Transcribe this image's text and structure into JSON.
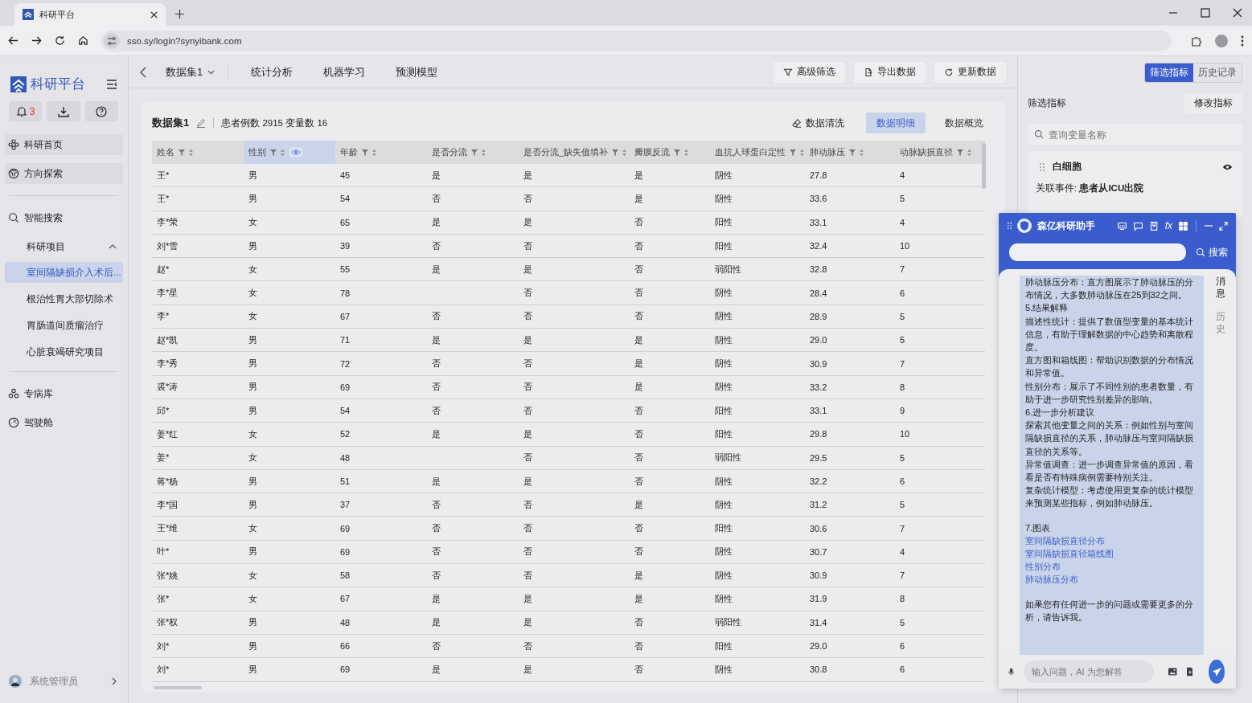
{
  "browser": {
    "tab_title": "科研平台",
    "url": "sso.sy/login?synyibank.com"
  },
  "sidebar": {
    "brand": "科研平台",
    "notification_count": "3",
    "items": [
      {
        "kind": "card",
        "label": "科研首页"
      },
      {
        "kind": "card",
        "label": "方向探索"
      },
      {
        "kind": "divider"
      },
      {
        "kind": "link",
        "label": "智能搜索"
      },
      {
        "kind": "group",
        "label": "科研项目",
        "expanded": true,
        "children": [
          {
            "label": "室间隔缺损介入术后...",
            "selected": true
          },
          {
            "label": "根治性胃大部切除术",
            "selected": false
          },
          {
            "label": "胃肠道间质瘤治疗",
            "selected": false
          },
          {
            "label": "心脏衰竭研究项目",
            "selected": false
          }
        ]
      },
      {
        "kind": "divider"
      },
      {
        "kind": "link",
        "label": "专病库"
      },
      {
        "kind": "link",
        "label": "驾驶舱"
      }
    ],
    "user": {
      "name": "系统管理员"
    }
  },
  "topbar": {
    "tabs": [
      {
        "label": "数据集1",
        "dropdown": true
      },
      {
        "label": "统计分析",
        "dropdown": false
      },
      {
        "label": "机器学习",
        "dropdown": false
      },
      {
        "label": "预测模型",
        "dropdown": false
      }
    ],
    "buttons": [
      {
        "label": "高级筛选"
      },
      {
        "label": "导出数据"
      },
      {
        "label": "更新数据"
      }
    ]
  },
  "dataset": {
    "title": "数据集1",
    "summary": "患者例数 2915 变量数 16",
    "action": "数据清洗",
    "views": [
      {
        "label": "数据明细",
        "selected": true
      },
      {
        "label": "数据概览",
        "selected": false
      }
    ]
  },
  "table": {
    "columns": [
      {
        "label": "姓名",
        "selected": false
      },
      {
        "label": "性别",
        "selected": true
      },
      {
        "label": "年龄",
        "selected": false
      },
      {
        "label": "是否分流",
        "selected": false
      },
      {
        "label": "是否分流_缺失值填补",
        "selected": false
      },
      {
        "label": "瓣膜反流",
        "selected": false
      },
      {
        "label": "血抗人球蛋白定性",
        "selected": false
      },
      {
        "label": "肺动脉压",
        "selected": false
      },
      {
        "label": "动脉缺损直径",
        "selected": false
      }
    ],
    "rows": [
      [
        "王*",
        "男",
        "45",
        "是",
        "是",
        "是",
        "阴性",
        "27.8",
        "4"
      ],
      [
        "王*",
        "男",
        "54",
        "否",
        "否",
        "是",
        "阴性",
        "33.6",
        "5"
      ],
      [
        "李*荣",
        "女",
        "65",
        "是",
        "是",
        "否",
        "阳性",
        "33.1",
        "4"
      ],
      [
        "刘*雪",
        "男",
        "39",
        "否",
        "否",
        "否",
        "阳性",
        "32.4",
        "10"
      ],
      [
        "赵*",
        "女",
        "55",
        "是",
        "是",
        "否",
        "弱阳性",
        "32.8",
        "7"
      ],
      [
        "李*星",
        "女",
        "78",
        null,
        "否",
        "否",
        "阴性",
        "28.4",
        "6"
      ],
      [
        "李*",
        "女",
        "67",
        "否",
        "否",
        "否",
        "阴性",
        "28.9",
        "5"
      ],
      [
        "赵*凯",
        "男",
        "71",
        "是",
        "是",
        "是",
        "阴性",
        "29.0",
        "5"
      ],
      [
        "李*秀",
        "男",
        "72",
        "否",
        "否",
        "是",
        "阴性",
        "30.9",
        "7"
      ],
      [
        "裘*涛",
        "男",
        "69",
        "否",
        "否",
        "是",
        "阴性",
        "33.2",
        "8"
      ],
      [
        "邱*",
        "男",
        "54",
        "否",
        "否",
        "否",
        "阳性",
        "33.1",
        "9"
      ],
      [
        "姜*红",
        "女",
        "52",
        "是",
        "是",
        "否",
        "阳性",
        "29.8",
        "10"
      ],
      [
        "姜*",
        "女",
        "48",
        null,
        "否",
        "否",
        "弱阳性",
        "29.5",
        "5"
      ],
      [
        "蒋*杨",
        "男",
        "51",
        "是",
        "是",
        "否",
        "阴性",
        "32.2",
        "6"
      ],
      [
        "李*国",
        "男",
        "37",
        "否",
        "否",
        "是",
        "阴性",
        "31.2",
        "5"
      ],
      [
        "王*维",
        "女",
        "69",
        "否",
        "否",
        "否",
        "阳性",
        "30.6",
        "7"
      ],
      [
        "叶*",
        "男",
        "69",
        "否",
        "否",
        "否",
        "阴性",
        "30.7",
        "4"
      ],
      [
        "张*姚",
        "女",
        "58",
        "否",
        "否",
        "是",
        "阴性",
        "30.9",
        "7"
      ],
      [
        "张*",
        "女",
        "67",
        "是",
        "是",
        "是",
        "阴性",
        "31.9",
        "8"
      ],
      [
        "张*权",
        "男",
        "48",
        "是",
        "是",
        "否",
        "弱阳性",
        "31.4",
        "5"
      ],
      [
        "刘*",
        "男",
        "66",
        "否",
        "否",
        "否",
        "阳性",
        "29.0",
        "6"
      ],
      [
        "刘*",
        "男",
        "69",
        "是",
        "是",
        "否",
        "阴性",
        "30.8",
        "6"
      ]
    ]
  },
  "right_panel": {
    "segments": [
      {
        "label": "筛选指标",
        "selected": true
      },
      {
        "label": "历史记录",
        "selected": false
      }
    ],
    "section_title": "筛选指标",
    "edit_button": "修改指标",
    "search_placeholder": "查询变量名称",
    "indicator": {
      "name": "白细胞",
      "visible": true,
      "event": "关联事件: **患者从ICU出院**"
    }
  },
  "assistant": {
    "title": "森亿科研助手",
    "toolbar": [
      {
        "kind": "icon"
      },
      {
        "kind": "icon"
      },
      {
        "kind": "icon"
      },
      {
        "kind": "text",
        "text": "fx"
      },
      {
        "kind": "icon"
      }
    ],
    "search_button": "搜索",
    "messages": [
      {
        "kind": "text",
        "text": "肺动脉压分布：直方图展示了肺动脉压的分布情况，大多数肺动脉压在25到32之间。"
      },
      {
        "kind": "text",
        "text": "5.结果解释"
      },
      {
        "kind": "text",
        "text": "描述性统计：提供了数值型变量的基本统计信息，有助于理解数据的中心趋势和离散程度。"
      },
      {
        "kind": "text",
        "text": "直方图和箱线图：帮助识别数据的分布情况和异常值。"
      },
      {
        "kind": "text",
        "text": "性别分布：展示了不同性别的患者数量，有助于进一步研究性别差异的影响。"
      },
      {
        "kind": "text",
        "text": "6.进一步分析建议"
      },
      {
        "kind": "text",
        "text": "探索其他变量之间的关系：例如性别与室间隔缺损直径的关系，肺动脉压与室间隔缺损直径的关系等。"
      },
      {
        "kind": "text",
        "text": "异常值调查：进一步调查异常值的原因，看看是否有特殊病例需要特别关注。"
      },
      {
        "kind": "text",
        "text": "复杂统计模型：考虑使用更复杂的统计模型来预测某些指标，例如肺动脉压。"
      },
      {
        "kind": "spaced",
        "text": "7.图表"
      },
      {
        "kind": "link",
        "text": "室间隔缺损直径分布"
      },
      {
        "kind": "link",
        "text": "室间隔缺损直径箱线图"
      },
      {
        "kind": "link",
        "text": "性别分布"
      },
      {
        "kind": "link",
        "text": "肺动脉压分布"
      },
      {
        "kind": "spaced",
        "text": "如果您有任何进一步的问题或需要更多的分析，请告诉我。"
      }
    ],
    "side_tabs": [
      {
        "label": "消息",
        "selected": true
      },
      {
        "label": "历史",
        "selected": false
      }
    ],
    "input_placeholder": "输入问题，AI 为您解答"
  }
}
